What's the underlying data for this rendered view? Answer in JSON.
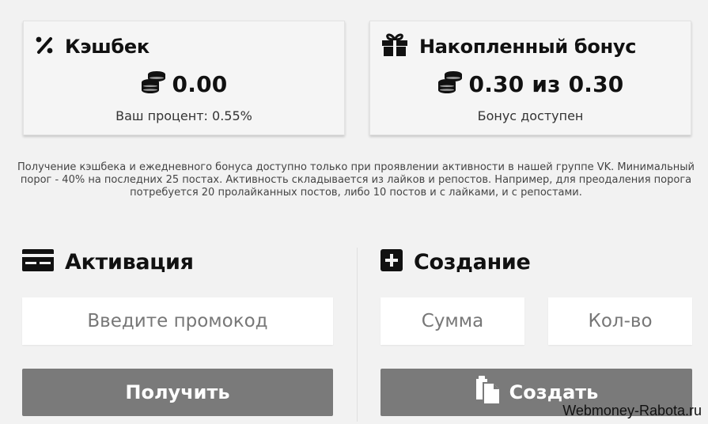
{
  "cashback": {
    "title": "Кэшбек",
    "value": "0.00",
    "subtitle": "Ваш процент: 0.55%"
  },
  "bonus": {
    "title": "Накопленный бонус",
    "value": "0.30 из 0.30",
    "subtitle": "Бонус доступен"
  },
  "notice": "Получение кэшбека и ежедневного бонуса доступно только при проявлении активности в нашей группе VK. Минимальный порог - 40% на последних 25 постах. Активность складывается из лайков и репостов. Например, для преодаления порога потребуется 20 пролайканных постов, либо 10 постов и с лайками, и с репостами.",
  "activation": {
    "title": "Активация",
    "promo_placeholder": "Введите промокод",
    "button": "Получить"
  },
  "creation": {
    "title": "Создание",
    "sum_placeholder": "Сумма",
    "qty_placeholder": "Кол-во",
    "button": "Создать"
  },
  "watermark": "Webmoney-Rabota.ru",
  "icons": {
    "cashback": "percent-icon",
    "coins": "coins-icon",
    "bonus": "gift-icon",
    "activation": "credit-card-icon",
    "creation": "plus-square-icon",
    "create_button": "copy-icon"
  },
  "colors": {
    "button_bg": "#7a7a7a",
    "page_bg": "#f2f2f2",
    "card_bg": "#f5f5f5"
  }
}
